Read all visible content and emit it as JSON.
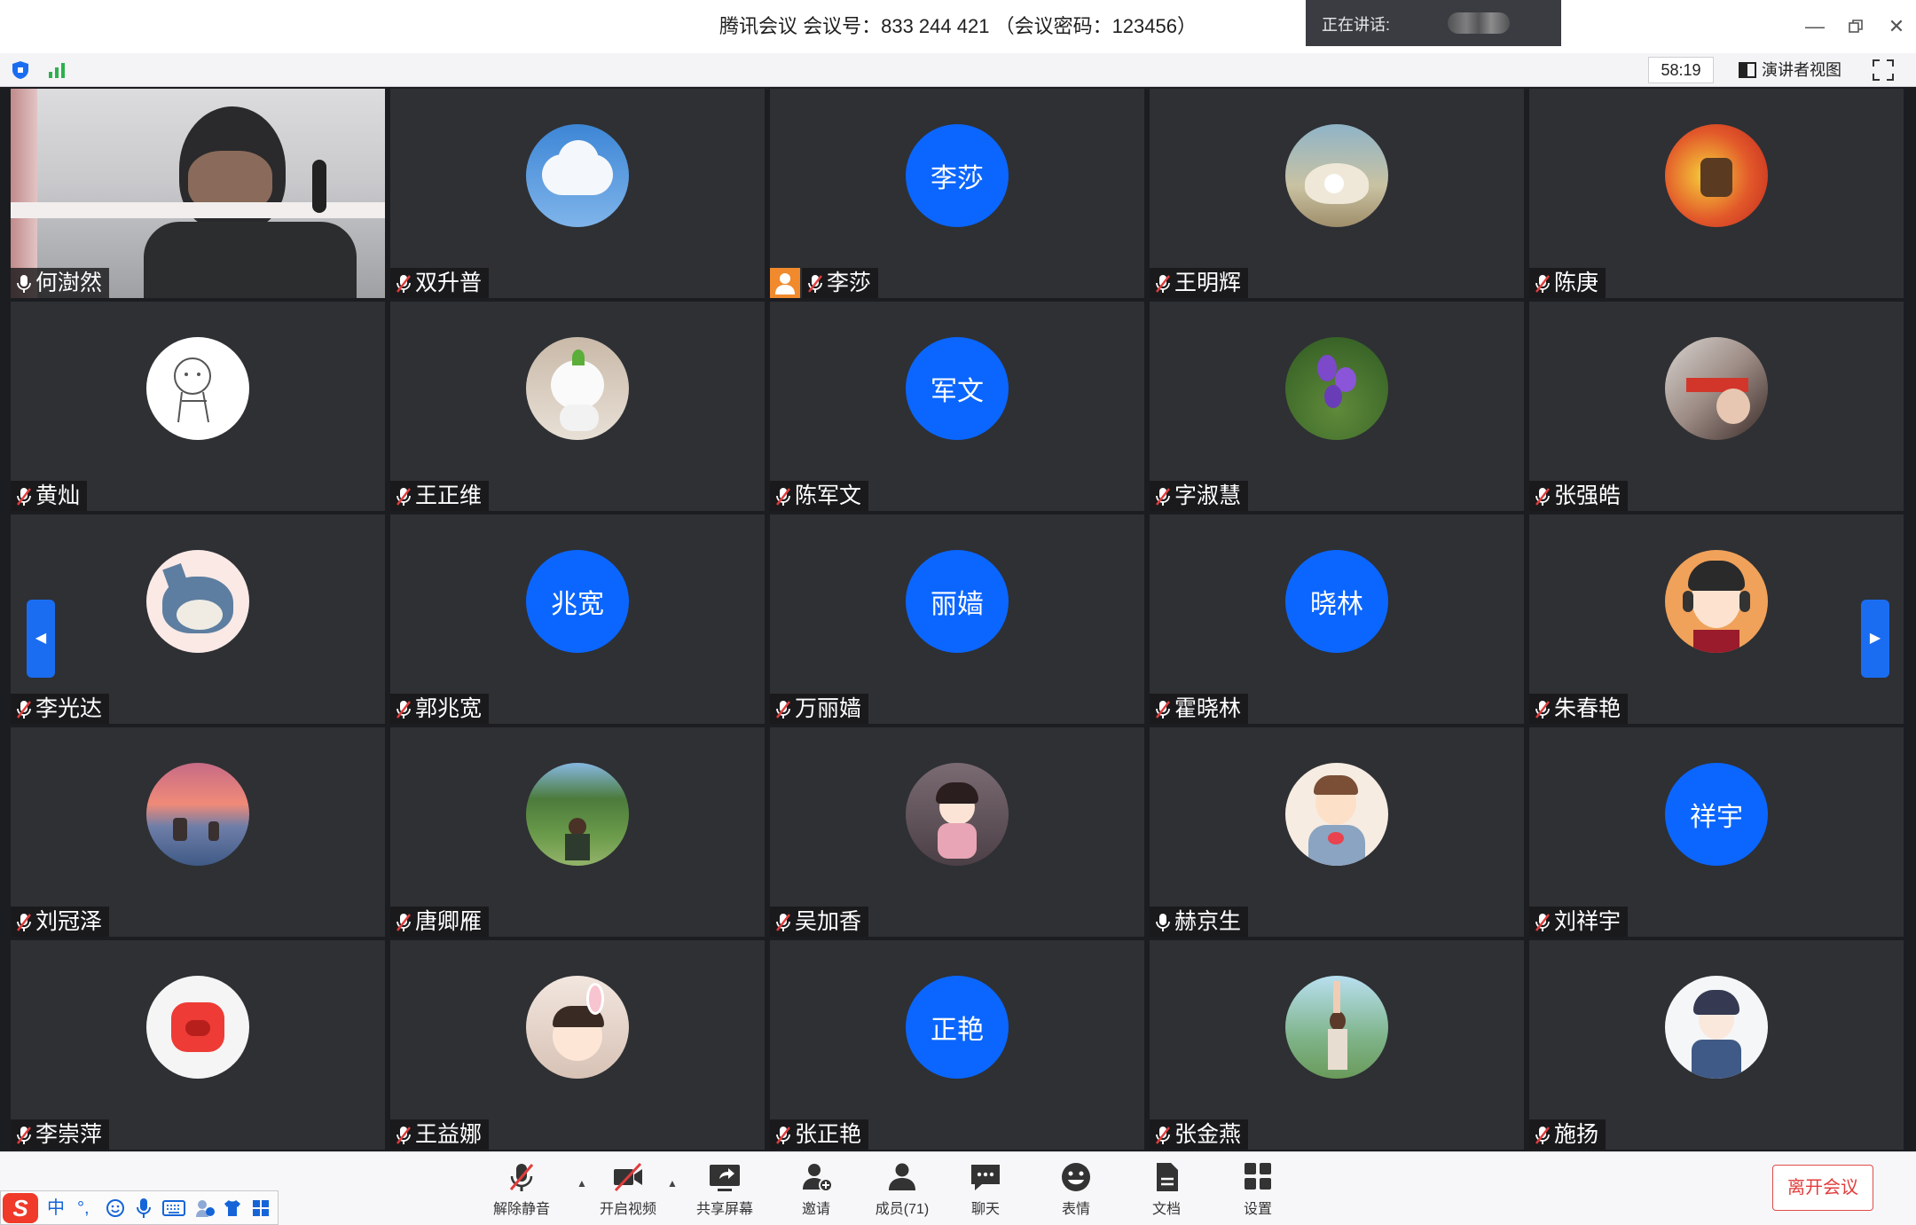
{
  "window": {
    "title": "腾讯会议 会议号：833 244 421 （会议密码：123456）",
    "speaking_label": "正在讲话:"
  },
  "infobar": {
    "timer": "58:19",
    "view_mode": "演讲者视图"
  },
  "participants": [
    {
      "name": "何澍然",
      "type": "video",
      "muted": false
    },
    {
      "name": "双升普",
      "type": "photo",
      "icon": "cloud-sky-avatar",
      "muted": true
    },
    {
      "name": "李莎",
      "type": "initials",
      "initials": "李莎",
      "muted": true,
      "host": true
    },
    {
      "name": "王明辉",
      "type": "photo",
      "icon": "seashell-avatar",
      "muted": true
    },
    {
      "name": "陈庚",
      "type": "photo",
      "icon": "poster-avatar",
      "muted": true
    },
    {
      "name": "黄灿",
      "type": "photo",
      "icon": "sketch-bear-avatar",
      "muted": true
    },
    {
      "name": "王正维",
      "type": "photo",
      "icon": "white-plush-avatar",
      "muted": true
    },
    {
      "name": "陈军文",
      "type": "initials",
      "initials": "军文",
      "muted": true
    },
    {
      "name": "字淑慧",
      "type": "photo",
      "icon": "purple-flower-avatar",
      "muted": true
    },
    {
      "name": "张强皓",
      "type": "photo",
      "icon": "collage-avatar",
      "muted": true
    },
    {
      "name": "李光达",
      "type": "photo",
      "icon": "cartoon-cat-avatar",
      "muted": true
    },
    {
      "name": "郭兆宽",
      "type": "initials",
      "initials": "兆宽",
      "muted": true
    },
    {
      "name": "万丽嫱",
      "type": "initials",
      "initials": "丽嫱",
      "muted": true
    },
    {
      "name": "霍晓林",
      "type": "initials",
      "initials": "晓林",
      "muted": true
    },
    {
      "name": "朱春艳",
      "type": "photo",
      "icon": "headphone-cartoon-avatar",
      "muted": true
    },
    {
      "name": "刘冠泽",
      "type": "photo",
      "icon": "sunset-sea-avatar",
      "muted": true
    },
    {
      "name": "唐卿雁",
      "type": "photo",
      "icon": "park-person-avatar",
      "muted": true
    },
    {
      "name": "吴加香",
      "type": "photo",
      "icon": "anime-girl-avatar",
      "muted": true
    },
    {
      "name": "赫京生",
      "type": "photo",
      "icon": "cartoon-boy-avatar",
      "muted": false
    },
    {
      "name": "刘祥宇",
      "type": "initials",
      "initials": "祥宇",
      "muted": true
    },
    {
      "name": "李崇萍",
      "type": "photo",
      "icon": "red-pig-avatar",
      "muted": true
    },
    {
      "name": "王益娜",
      "type": "photo",
      "icon": "child-bunny-avatar",
      "muted": true
    },
    {
      "name": "张正艳",
      "type": "initials",
      "initials": "正艳",
      "muted": true
    },
    {
      "name": "张金燕",
      "type": "photo",
      "icon": "stretching-girl-avatar",
      "muted": true
    },
    {
      "name": "施扬",
      "type": "photo",
      "icon": "anime-boy-avatar",
      "muted": true
    }
  ],
  "toolbar": {
    "unmute": "解除静音",
    "start_video": "开启视频",
    "share_screen": "共享屏幕",
    "invite": "邀请",
    "members": "成员(71)",
    "chat": "聊天",
    "reactions": "表情",
    "docs": "文档",
    "settings": "设置",
    "leave": "离开会议"
  },
  "ime": {
    "logo": "S",
    "mode": "中",
    "punct": "°,"
  },
  "colors": {
    "accent_blue": "#0a66ff",
    "leave_red": "#e23c3c",
    "tile_bg": "#2e3034",
    "host_orange": "#f08a2c"
  }
}
